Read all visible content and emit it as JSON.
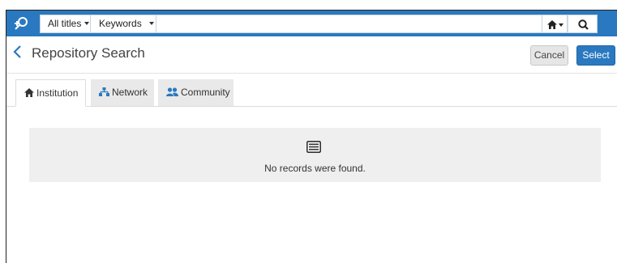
{
  "topbar": {
    "scope_label": "All titles",
    "keyword_label": "Keywords",
    "search_value": "",
    "accent": "#2a79c0"
  },
  "header": {
    "title": "Repository Search",
    "cancel_label": "Cancel",
    "select_label": "Select"
  },
  "tabs": [
    {
      "label": "Institution",
      "icon": "home-icon",
      "active": true
    },
    {
      "label": "Network",
      "icon": "sitemap-icon",
      "active": false
    },
    {
      "label": "Community",
      "icon": "users-icon",
      "active": false
    }
  ],
  "empty_state": {
    "icon": "list-icon",
    "message": "No records were found."
  }
}
